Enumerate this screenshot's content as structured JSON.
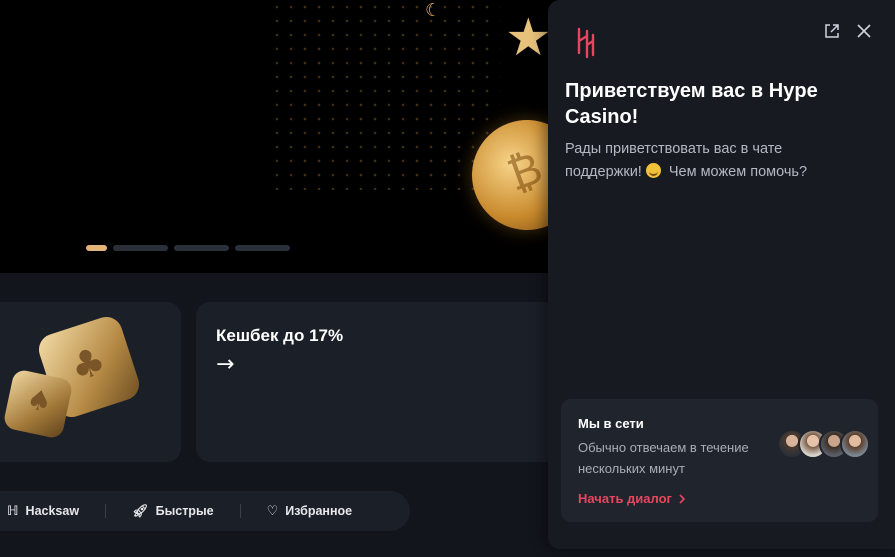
{
  "hero": {
    "slides_total": 4,
    "active_slide": 1
  },
  "promos": {
    "cashback_title": "Кешбек до 17%",
    "cashback_arrow": "→"
  },
  "categories": [
    {
      "label": "Hacksaw",
      "icon": "hacksaw-icon"
    },
    {
      "label": "Быстрые",
      "icon": "rocket-icon"
    },
    {
      "label": "Избранное",
      "icon": "heart-icon"
    }
  ],
  "chat": {
    "brand_color": "#e8455f",
    "welcome_title": "Приветствуем вас в Hype Casino!",
    "welcome_line1": "Рады приветствовать вас в чате поддержки!",
    "welcome_line2": "Чем можем помочь?",
    "status": {
      "title": "Мы в сети",
      "text": "Обычно отвечаем в течение нескольких минут",
      "start_label": "Начать диалог"
    },
    "agents": [
      "agent-1",
      "agent-2",
      "agent-3",
      "agent-4"
    ]
  }
}
